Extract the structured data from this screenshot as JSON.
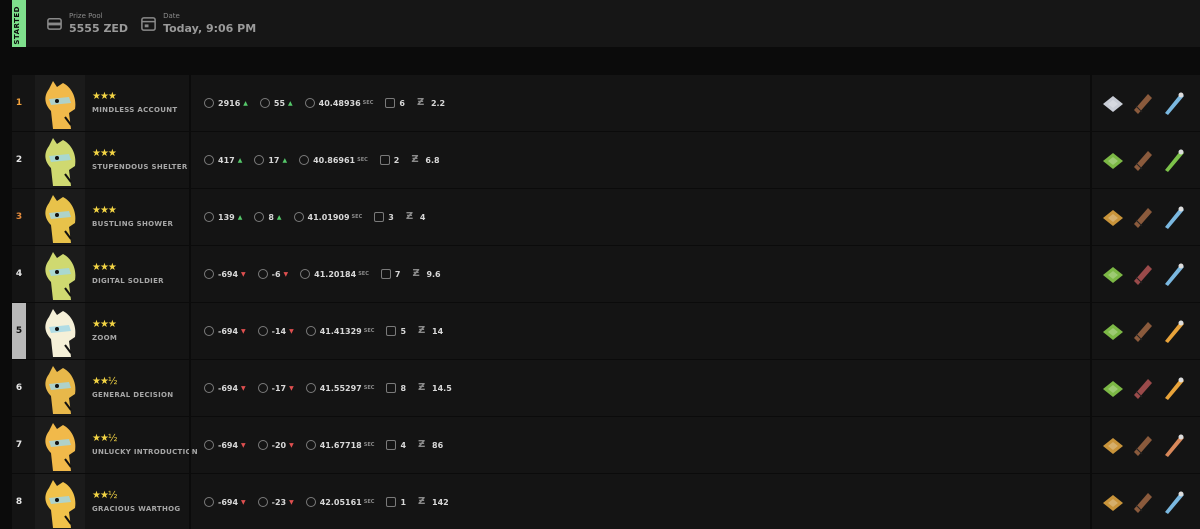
{
  "header": {
    "status_label": "STARTED",
    "prize_pool_label": "Prize Pool",
    "prize_pool_value": "5555 ZED",
    "date_label": "Date",
    "date_value": "Today, 9:06 PM"
  },
  "colors": {
    "accent_green": "#7ee08c",
    "star_gold": "#f3d444",
    "up_green": "#55c86a",
    "down_red": "#e05050"
  },
  "units": {
    "seconds": "SEC"
  },
  "rows": [
    {
      "rank": "1",
      "rank_color": "#f0a03c",
      "stars": "★★★",
      "name": "MINDLESS ACCOUNT",
      "points": "2916",
      "points_dir": "up",
      "rating": "55",
      "rating_dir": "up",
      "time": "40.48936",
      "gates": "6",
      "odds": "2.2",
      "horse_color": "#f1b94a",
      "gear": [
        "#c9cdd6",
        "#8a5a3c",
        "#7ab8e0"
      ],
      "highlight": false
    },
    {
      "rank": "2",
      "rank_color": "#e6e6e6",
      "stars": "★★★",
      "name": "STUPENDOUS SHELTER",
      "points": "417",
      "points_dir": "up",
      "rating": "17",
      "rating_dir": "up",
      "time": "40.86961",
      "gates": "2",
      "odds": "6.8",
      "horse_color": "#cfd970",
      "gear": [
        "#7cb845",
        "#8a5a3c",
        "#7cc24a"
      ],
      "highlight": false
    },
    {
      "rank": "3",
      "rank_color": "#e38a3b",
      "stars": "★★★",
      "name": "BUSTLING SHOWER",
      "points": "139",
      "points_dir": "up",
      "rating": "8",
      "rating_dir": "up",
      "time": "41.01909",
      "gates": "3",
      "odds": "4",
      "horse_color": "#e8c24a",
      "gear": [
        "#c9943a",
        "#8a5a3c",
        "#7ab8e0"
      ],
      "highlight": false
    },
    {
      "rank": "4",
      "rank_color": "#e6e6e6",
      "stars": "★★★",
      "name": "DIGITAL SOLDIER",
      "points": "-694",
      "points_dir": "down",
      "rating": "-6",
      "rating_dir": "down",
      "time": "41.20184",
      "gates": "7",
      "odds": "9.6",
      "horse_color": "#cfd970",
      "gear": [
        "#7cb845",
        "#9a4a4a",
        "#7ab8e0"
      ],
      "highlight": false
    },
    {
      "rank": "5",
      "rank_color": "#111111",
      "stars": "★★★",
      "name": "ZOOM",
      "points": "-694",
      "points_dir": "down",
      "rating": "-14",
      "rating_dir": "down",
      "time": "41.41329",
      "gates": "5",
      "odds": "14",
      "horse_color": "#f5f0d8",
      "gear": [
        "#7cb845",
        "#8a5a3c",
        "#e8a33a"
      ],
      "highlight": true
    },
    {
      "rank": "6",
      "rank_color": "#e6e6e6",
      "stars": "★★½",
      "name": "GENERAL DECISION",
      "points": "-694",
      "points_dir": "down",
      "rating": "-17",
      "rating_dir": "down",
      "time": "41.55297",
      "gates": "8",
      "odds": "14.5",
      "horse_color": "#e8b84a",
      "gear": [
        "#7cb845",
        "#9a4a4a",
        "#e8a33a"
      ],
      "highlight": false
    },
    {
      "rank": "7",
      "rank_color": "#e6e6e6",
      "stars": "★★½",
      "name": "UNLUCKY INTRODUCTION",
      "points": "-694",
      "points_dir": "down",
      "rating": "-20",
      "rating_dir": "down",
      "time": "41.67718",
      "gates": "4",
      "odds": "86",
      "horse_color": "#f1b94a",
      "gear": [
        "#c9943a",
        "#8a5a3c",
        "#d8885a"
      ],
      "highlight": false
    },
    {
      "rank": "8",
      "rank_color": "#e6e6e6",
      "stars": "★★½",
      "name": "GRACIOUS WARTHOG",
      "points": "-694",
      "points_dir": "down",
      "rating": "-23",
      "rating_dir": "down",
      "time": "42.05161",
      "gates": "1",
      "odds": "142",
      "horse_color": "#f1c24a",
      "gear": [
        "#c9943a",
        "#8a5a3c",
        "#7ab8e0"
      ],
      "highlight": false
    }
  ]
}
